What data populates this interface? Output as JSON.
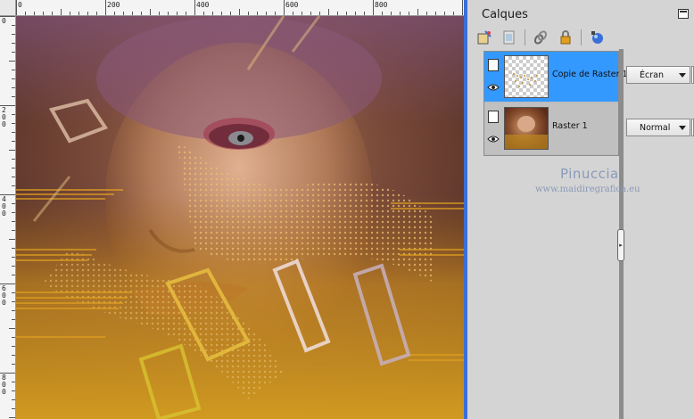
{
  "ruler": {
    "top_labels": [
      "0",
      "200",
      "400",
      "600",
      "800"
    ],
    "left_labels": [
      "0",
      "200",
      "400",
      "600",
      "800"
    ]
  },
  "panel": {
    "title": "Calques",
    "toolbar_icons": [
      "new-layer-icon",
      "new-group-icon",
      "link-icon",
      "lock-icon",
      "mask-icon"
    ]
  },
  "layers": [
    {
      "name": "Copie de Raster 1",
      "blend_mode": "Écran",
      "selected": true,
      "visible": true
    },
    {
      "name": "Raster 1",
      "blend_mode": "Normal",
      "selected": false,
      "visible": true
    }
  ],
  "watermark": {
    "name": "Pinuccia",
    "url": "www.maidiregrafica.eu"
  },
  "colors": {
    "selection": "#3399ff",
    "canvas_border": "#3a6fd8",
    "watermark": "#8a9ab8"
  }
}
